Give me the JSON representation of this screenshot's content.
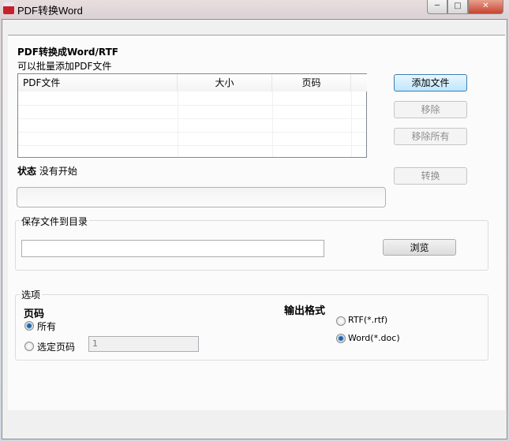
{
  "window": {
    "title": "PDF转换Word",
    "minimize": "─",
    "maximize": "□",
    "close": "✕"
  },
  "heading": "PDF转换成Word/RTF",
  "subheading": "可以批量添加PDF文件",
  "table": {
    "columns": [
      "PDF文件",
      "大小",
      "页码"
    ],
    "rows": []
  },
  "buttons": {
    "add": "添加文件",
    "remove": "移除",
    "remove_all": "移除所有",
    "convert": "转换",
    "browse": "浏览"
  },
  "status": {
    "label": "状态",
    "value": "没有开始",
    "progress": 0
  },
  "save": {
    "legend": "保存文件到目录",
    "path": ""
  },
  "options": {
    "legend": "选项",
    "pages_label": "页码",
    "all": "所有",
    "selected": "选定页码",
    "page_value": "1",
    "format_label": "输出格式",
    "rtf": "RTF(*.rtf)",
    "doc": "Word(*.doc)",
    "selected_pages_mode": "all",
    "selected_format": "doc"
  }
}
